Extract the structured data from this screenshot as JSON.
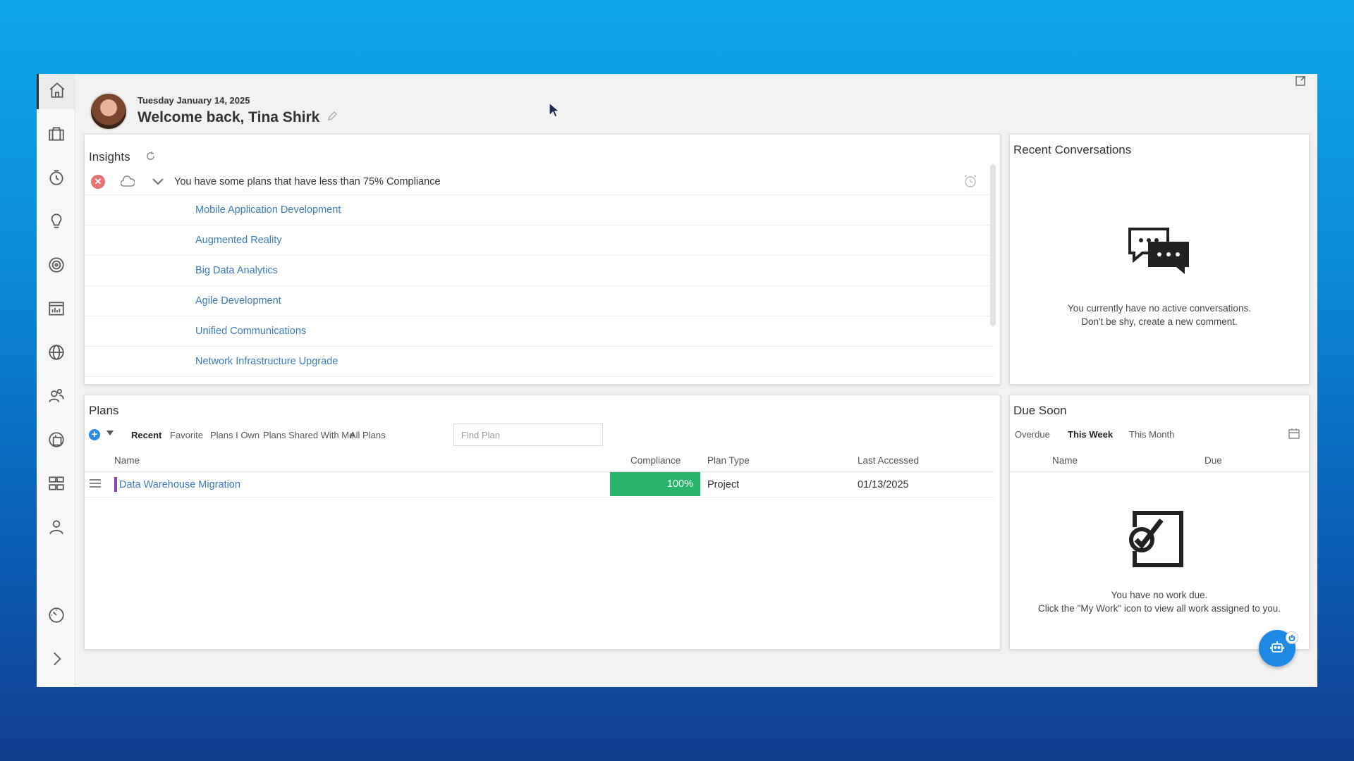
{
  "header": {
    "date": "Tuesday January 14, 2025",
    "welcome": "Welcome back, Tina Shirk"
  },
  "sidebar": {
    "items": [
      {
        "icon": "home-icon"
      },
      {
        "icon": "briefcase-icon"
      },
      {
        "icon": "timer-icon"
      },
      {
        "icon": "lightbulb-icon"
      },
      {
        "icon": "target-icon"
      },
      {
        "icon": "report-chart-icon"
      },
      {
        "icon": "globe-icon"
      },
      {
        "icon": "users-icon"
      },
      {
        "icon": "portfolio-icon"
      },
      {
        "icon": "hierarchy-icon"
      },
      {
        "icon": "user-icon"
      },
      {
        "icon": "dashboard-gauge-icon"
      },
      {
        "icon": "chevron-right-icon"
      }
    ]
  },
  "insights": {
    "title": "Insights",
    "alert": "You have some plans that have less than 75% Compliance",
    "items": [
      "Mobile Application Development",
      "Augmented Reality",
      "Big Data Analytics",
      "Agile Development",
      "Unified Communications",
      "Network Infrastructure Upgrade"
    ]
  },
  "conversations": {
    "title": "Recent Conversations",
    "empty_line1": "You currently have no active conversations.",
    "empty_line2": "Don't be shy, create a new comment."
  },
  "plans": {
    "title": "Plans",
    "tabs": [
      "Recent",
      "Favorite",
      "Plans I Own",
      "Plans Shared With Me",
      "All Plans"
    ],
    "active_tab": "Recent",
    "search_placeholder": "Find Plan",
    "columns": {
      "name": "Name",
      "compliance": "Compliance",
      "plan_type": "Plan Type",
      "last_accessed": "Last Accessed"
    },
    "rows": [
      {
        "name": "Data Warehouse Migration",
        "compliance": "100%",
        "compliance_value": 1.0,
        "plan_type": "Project",
        "last_accessed": "01/13/2025",
        "marker_color": "#8e44ad",
        "compliance_color": "#2ab56d"
      }
    ]
  },
  "due_soon": {
    "title": "Due Soon",
    "tabs": [
      "Overdue",
      "This Week",
      "This Month"
    ],
    "active_tab": "This Week",
    "columns": {
      "name": "Name",
      "due": "Due"
    },
    "empty_line1": "You have no work due.",
    "empty_line2": "Click the \"My Work\" icon to view all work assigned to you."
  },
  "colors": {
    "accent": "#1e88e5",
    "link": "#3d7ab8",
    "success": "#2ab56d",
    "error": "#e57373"
  }
}
